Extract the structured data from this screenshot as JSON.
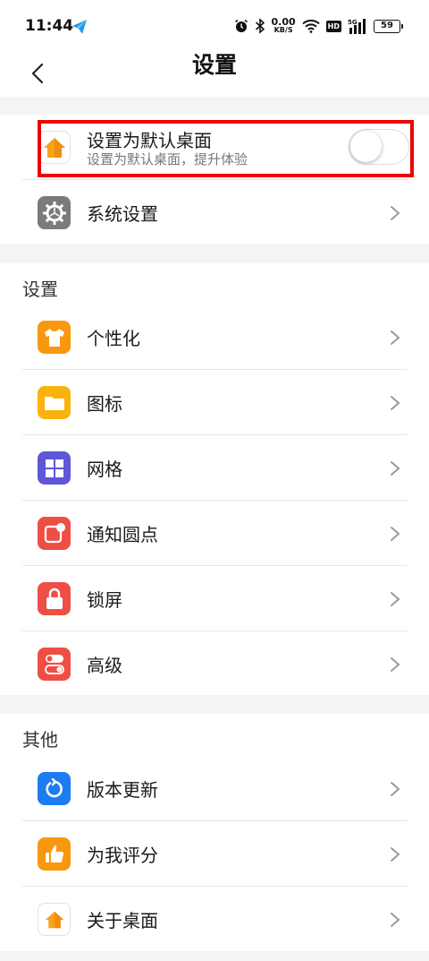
{
  "status_bar": {
    "time": "11:44",
    "net_speed_value": "0.00",
    "net_speed_unit": "KB/S",
    "hd_label": "HD",
    "network_type": "5G",
    "battery": "59"
  },
  "header": {
    "title": "设置"
  },
  "default_launcher": {
    "title": "设置为默认桌面",
    "subtitle": "设置为默认桌面，提升体验",
    "enabled": false
  },
  "system_settings": {
    "label": "系统设置"
  },
  "sections": {
    "settings_title": "设置",
    "other_title": "其他"
  },
  "settings_items": [
    {
      "label": "个性化",
      "icon": "tshirt-icon",
      "color": "#f9970f"
    },
    {
      "label": "图标",
      "icon": "folder-icon",
      "color": "#fbb20e"
    },
    {
      "label": "网格",
      "icon": "grid-icon",
      "color": "#5f57d8"
    },
    {
      "label": "通知圆点",
      "icon": "notification-dot-icon",
      "color": "#ee4f45"
    },
    {
      "label": "锁屏",
      "icon": "lock-icon",
      "color": "#ee4f45"
    },
    {
      "label": "高级",
      "icon": "toggles-icon",
      "color": "#ee4f45"
    }
  ],
  "other_items": [
    {
      "label": "版本更新",
      "icon": "refresh-icon",
      "color": "#1d7cf2"
    },
    {
      "label": "为我评分",
      "icon": "thumbs-up-icon",
      "color": "#f9970f"
    },
    {
      "label": "关于桌面",
      "icon": "house-icon",
      "color": "#ffffff"
    }
  ],
  "colors": {
    "highlight_border": "#ee0000",
    "background": "#f4f4f4"
  }
}
